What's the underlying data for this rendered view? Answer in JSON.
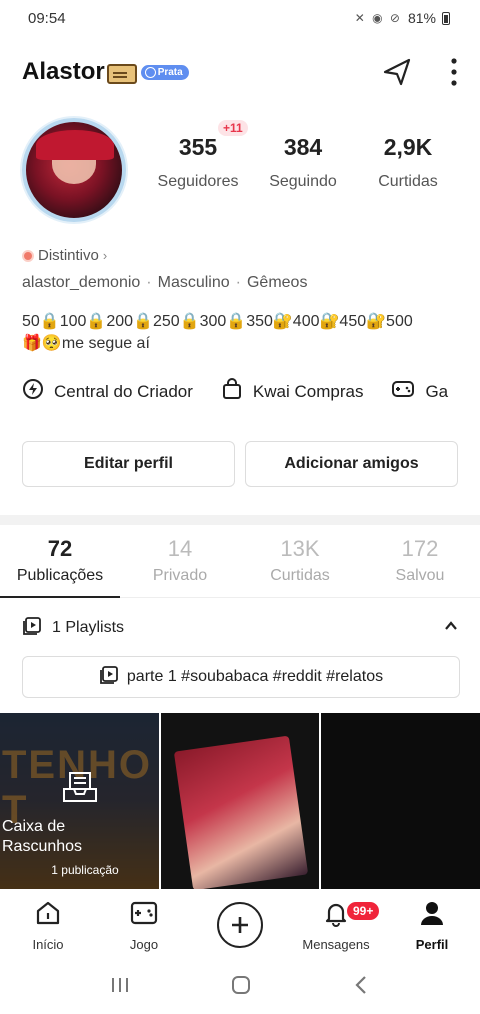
{
  "status_bar": {
    "time": "09:54",
    "icons": "✕ ◉ ⊘",
    "battery": "81%"
  },
  "header": {
    "username": "Alastor",
    "tier_badge": "Prata"
  },
  "profile": {
    "stats": [
      {
        "value": "355",
        "label": "Seguidores",
        "delta": "+11"
      },
      {
        "value": "384",
        "label": "Seguindo"
      },
      {
        "value": "2,9K",
        "label": "Curtidas"
      }
    ],
    "badge_label": "Distintivo",
    "handle": "alastor_demonio",
    "gender": "Masculino",
    "sign": "Gêmeos",
    "bio_line1": "50🔒100🔒200🔒250🔒300🔒350🔐400🔐450🔐500",
    "bio_line2": "🎁🥺me segue aí"
  },
  "creator_tools": [
    {
      "label": "Central do Criador",
      "icon": "lightning-icon"
    },
    {
      "label": "Kwai Compras",
      "icon": "shopping-bag-icon"
    },
    {
      "label": "Ga",
      "icon": "gamepad-icon"
    }
  ],
  "actions": {
    "edit_profile": "Editar perfil",
    "add_friends": "Adicionar amigos"
  },
  "tabs": [
    {
      "count": "72",
      "label": "Publicações"
    },
    {
      "count": "14",
      "label": "Privado"
    },
    {
      "count": "13K",
      "label": "Curtidas"
    },
    {
      "count": "172",
      "label": "Salvou"
    }
  ],
  "playlists": {
    "header": "1 Playlists",
    "item": "parte 1 #soubabaca #reddit #relatos"
  },
  "grid": {
    "drafts_bg_text": "TENHO T",
    "drafts_title": "Caixa de Rascunhos",
    "drafts_count": "1 publicação"
  },
  "bottom_nav": {
    "items": [
      {
        "label": "Início",
        "icon": "home-icon"
      },
      {
        "label": "Jogo",
        "icon": "gamepad-icon"
      },
      {
        "label": "",
        "icon": "plus-icon"
      },
      {
        "label": "Mensagens",
        "icon": "bell-icon",
        "badge": "99+"
      },
      {
        "label": "Perfil",
        "icon": "person-icon"
      }
    ]
  },
  "colors": {
    "accent_red": "#f0243a",
    "tier_blue": "#5f8ef0"
  }
}
